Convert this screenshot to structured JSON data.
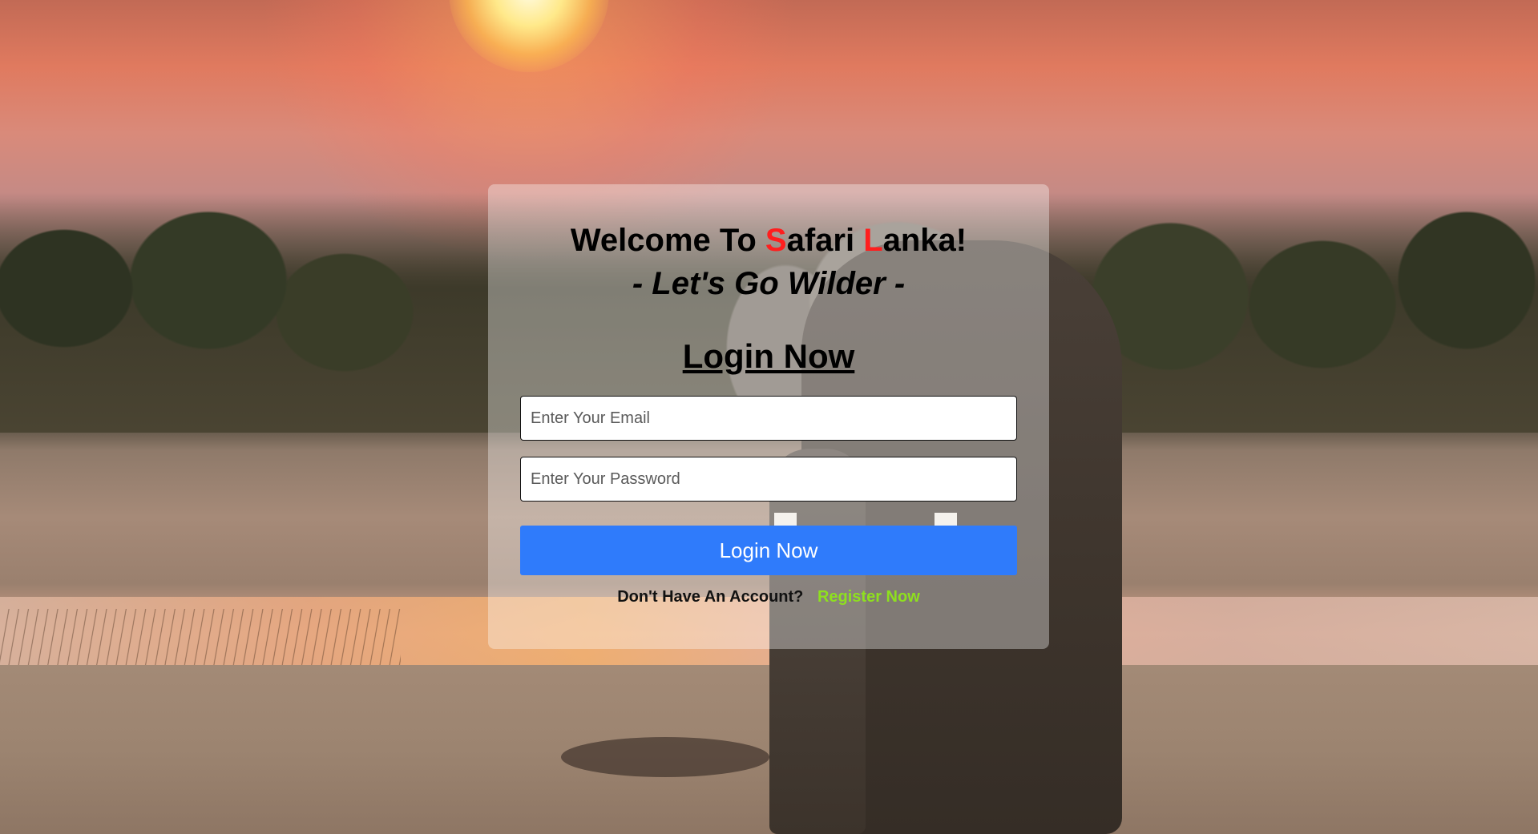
{
  "header": {
    "welcome_prefix": "Welcome To ",
    "brand_first_initial": "S",
    "brand_first_rest": "afari ",
    "brand_second_initial": "L",
    "brand_second_rest": "anka!",
    "tagline": "- Let's Go Wilder -"
  },
  "form": {
    "title": "Login Now",
    "email_placeholder": "Enter Your Email",
    "email_value": "",
    "password_placeholder": "Enter Your Password",
    "password_value": "",
    "submit_label": "Login Now",
    "no_account_text": "Don't Have An Account?",
    "register_label": "Register Now"
  },
  "colors": {
    "brand_accent": "#ff1e1e",
    "button": "#2f7bfb",
    "register_link": "#8ee01e"
  }
}
